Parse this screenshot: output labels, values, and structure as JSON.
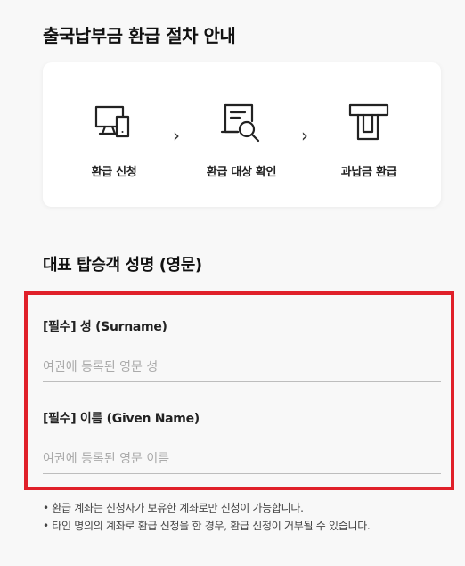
{
  "page": {
    "title": "출국납부금 환급 절차 안내"
  },
  "steps": [
    {
      "label": "환급 신청",
      "icon": "computer-icon"
    },
    {
      "label": "환급 대상 확인",
      "icon": "document-search-icon"
    },
    {
      "label": "과납금 환급",
      "icon": "payment-terminal-icon"
    }
  ],
  "separator": "›",
  "section": {
    "title": "대표 탑승객 성명 (영문)"
  },
  "form": {
    "surname": {
      "label": "[필수] 성 (Surname)",
      "placeholder": "여권에 등록된 영문 성",
      "value": ""
    },
    "given_name": {
      "label": "[필수] 이름 (Given Name)",
      "placeholder": "여권에 등록된 영문 이름",
      "value": ""
    },
    "highlight_color": "#e0202a"
  },
  "notes": [
    "환급 계좌는 신청자가 보유한 계좌로만 신청이 가능합니다.",
    "타인 명의의 계좌로 환급 신청을 한 경우, 환급 신청이 거부될 수 있습니다."
  ]
}
